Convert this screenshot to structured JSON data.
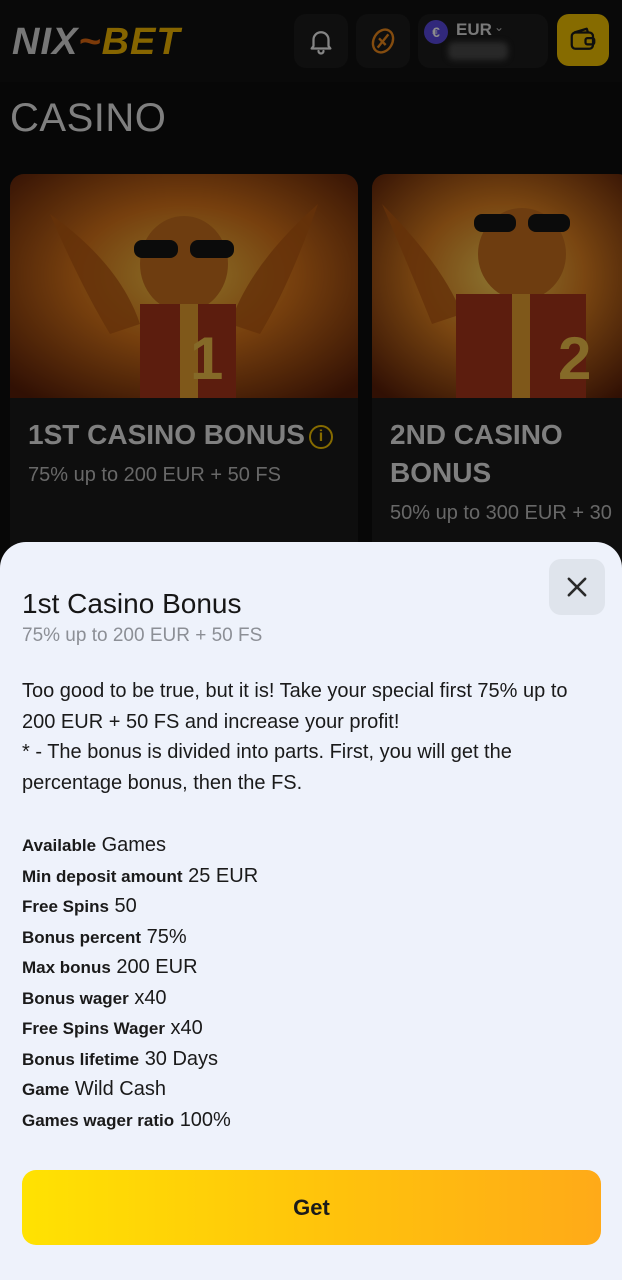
{
  "header": {
    "logo": {
      "part1": "NIX",
      "flame": "~",
      "part2": "BET"
    },
    "notifications_icon": "bell-icon",
    "spin_icon": "wheel-icon",
    "currency": {
      "coin_symbol": "€",
      "code": "EUR",
      "chevron": "⌄"
    },
    "wallet_icon": "wallet-icon"
  },
  "section": {
    "title": "CASINO"
  },
  "cards": [
    {
      "title": "1ST CASINO BONUS",
      "subtitle": "75% up to 200 EUR + 50 FS",
      "info": "i"
    },
    {
      "title": "2ND CASINO BONUS",
      "subtitle": "50% up to 300 EUR + 30"
    }
  ],
  "modal": {
    "title": "1st Casino Bonus",
    "subtitle": "75% up to 200 EUR + 50 FS",
    "description": [
      "Too good to be true, but it is! Take your special first 75% up to 200 EUR + 50 FS and increase your profit!",
      "* - The bonus is divided into parts. First, you will get the percentage bonus, then the FS."
    ],
    "details": [
      {
        "label": "Available",
        "value": "Games"
      },
      {
        "label": "Min deposit amount",
        "value": "25 EUR"
      },
      {
        "label": "Free Spins",
        "value": "50"
      },
      {
        "label": "Bonus percent",
        "value": "75%"
      },
      {
        "label": "Max bonus",
        "value": "200 EUR"
      },
      {
        "label": "Bonus wager",
        "value": "x40"
      },
      {
        "label": "Free Spins Wager",
        "value": "x40"
      },
      {
        "label": "Bonus lifetime",
        "value": "30 Days"
      },
      {
        "label": "Game",
        "value": "Wild Cash"
      },
      {
        "label": "Games wager ratio",
        "value": "100%"
      }
    ],
    "get_button": "Get",
    "close_icon": "close-icon"
  },
  "colors": {
    "accent": "#f5c400",
    "sheet_background": "#eef2fb",
    "button_gradient": [
      "#ffe202",
      "#ffaa18"
    ]
  }
}
